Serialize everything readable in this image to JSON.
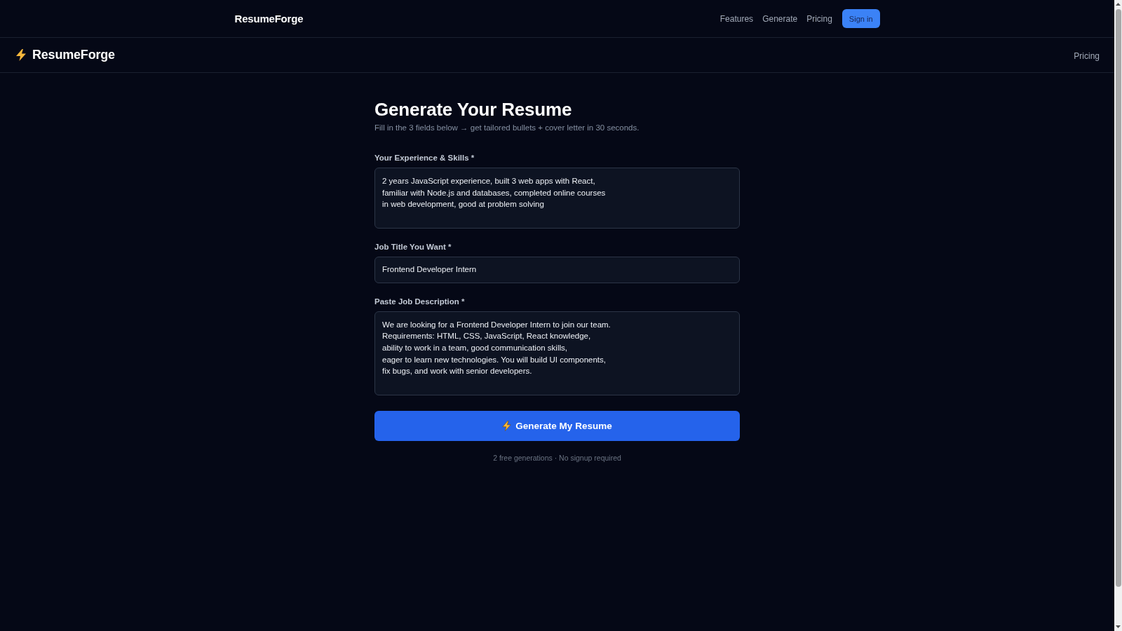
{
  "top_nav": {
    "logo": "ResumeForge",
    "links": [
      "Features",
      "Generate",
      "Pricing"
    ],
    "button": "Sign in"
  },
  "header": {
    "logo": "ResumeForge",
    "links": [
      "Pricing"
    ]
  },
  "form": {
    "title": "Generate Your Resume",
    "subtitle": "Fill in the 3 fields below → get tailored bullets + cover letter in 30 seconds.",
    "fields": [
      {
        "kind": "textarea",
        "label": "Your Experience & Skills *",
        "value": "2 years JavaScript experience, built 3 web apps with React,\nfamiliar with Node.js and databases, completed online courses\nin web development, good at problem solving"
      },
      {
        "kind": "input",
        "label": "Job Title You Want *",
        "value": "Frontend Developer Intern"
      },
      {
        "kind": "textarea",
        "label": "Paste Job Description *",
        "value": "We are looking for a Frontend Developer Intern to join our team.\nRequirements: HTML, CSS, JavaScript, React knowledge,\nability to work in a team, good communication skills,\neager to learn new technologies. You will build UI components,\nfix bugs, and work with senior developers."
      }
    ],
    "submit": "Generate My Resume",
    "note": "2 free generations · No signup required"
  }
}
